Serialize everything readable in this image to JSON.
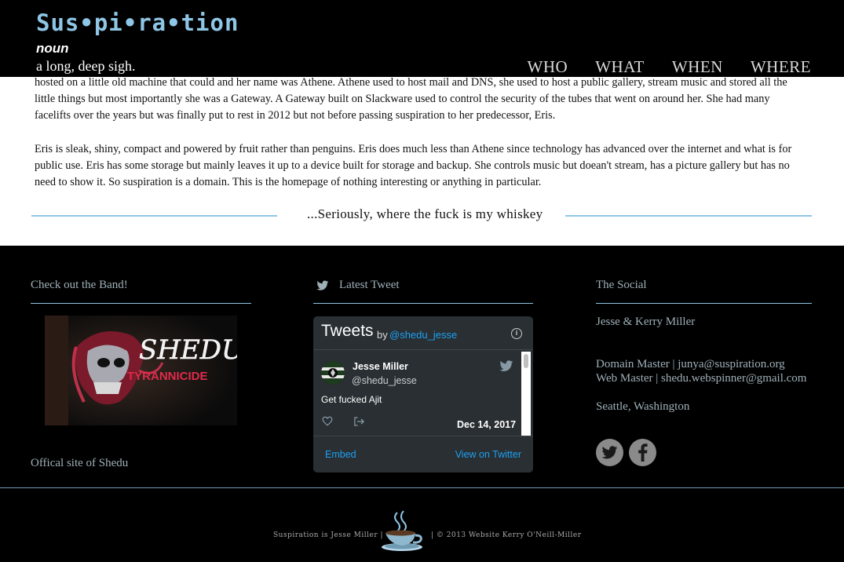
{
  "header": {
    "brand": "Sus•pi•ra•tion",
    "part_of_speech": "noun",
    "definition": "a long, deep sigh.",
    "nav": [
      "WHO",
      "WHAT",
      "WHEN",
      "WHERE"
    ]
  },
  "main": {
    "paragraph_1": "hosted on a little old machine that could and her name was Athene. Athene used to host mail and DNS, she used to host a public gallery, stream music and stored all the little things but most importantly she was a Gateway. A Gateway built on Slackware used to control the security of the tubes that went on around her. She had many facelifts over the years but was finally put to rest in 2012 but not before passing suspiration to her predecessor, Eris.",
    "paragraph_2": "Eris is sleak, shiny, compact and powered by fruit rather than penguins. Eris does much less than Athene since technology has advanced over the internet and what is for public use. Eris has some storage but mainly leaves it up to a device built for storage and backup. She controls music but doean't stream, has a picture gallery but has no need to show it. So suspiration is a domain. This is the homepage of nothing interesting or anything in particular.",
    "quote": "...Seriously, where the fuck is my whiskey"
  },
  "footer": {
    "band": {
      "title": "Check out the Band!",
      "caption": "Offical site of Shedu",
      "image_word_1": "SHEDU",
      "image_word_2": "TYRANNICIDE"
    },
    "tweets": {
      "title": "Latest Tweet",
      "widget_title": "Tweets",
      "widget_by": "by",
      "widget_handle": "@shedu_jesse",
      "tweet_name": "Jesse Miller",
      "tweet_user": "@shedu_jesse",
      "tweet_text": "Get fucked Ajit",
      "tweet_date": "Dec 14, 2017",
      "embed_label": "Embed",
      "view_label": "View on Twitter"
    },
    "social": {
      "title": "The Social",
      "names": "Jesse & Kerry Miller",
      "domain_master": "Domain Master | junya@suspiration.org",
      "web_master": "Web Master | shedu.webspinner@gmail.com",
      "location": "Seattle, Washington",
      "icons": [
        "twitter-icon",
        "facebook-icon"
      ]
    },
    "bottom_left": "Suspiration is Jesse Miller |",
    "bottom_right": "| © 2013 Website Kerry O'Neill-Miller"
  },
  "colors": {
    "accent": "#8ec6e6",
    "footer_text": "#9fb0b8",
    "twitter_blue": "#1da1f2",
    "widget_bg": "#292f33"
  }
}
